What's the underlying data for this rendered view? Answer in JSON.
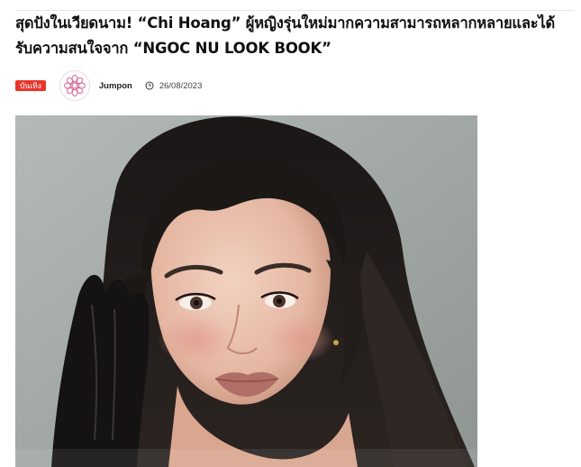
{
  "article": {
    "title": "สุดปังในเวียดนาม! “Chi Hoang” ผู้หญิงรุ่นใหม่มากความสามารถหลากหลายและได้รับความสนใจจาก “NGOC NU LOOK BOOK”",
    "category_badge": "บันเทิง",
    "author": "Jumpon",
    "date": "26/08/2023",
    "author_avatar_icon": "flower-logo-icon",
    "date_icon": "clock-icon",
    "badge_color": "#e8352b"
  }
}
